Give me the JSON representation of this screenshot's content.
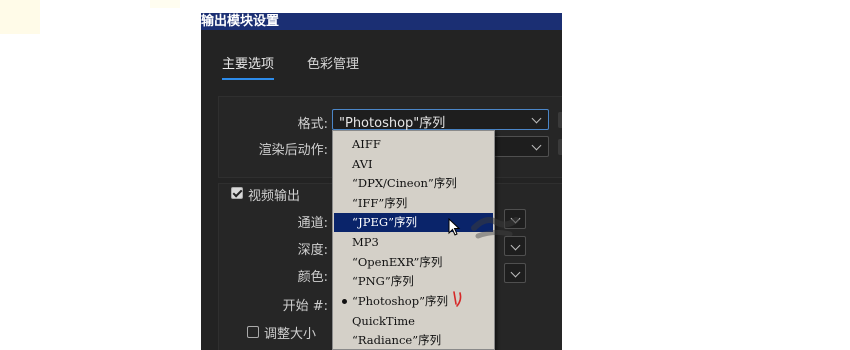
{
  "dialog": {
    "title": "输出模块设置"
  },
  "tabs": [
    {
      "label": "主要选项",
      "active": true
    },
    {
      "label": "色彩管理",
      "active": false
    }
  ],
  "format": {
    "label": "格式:",
    "value": "\"Photoshop\"序列"
  },
  "post_render": {
    "label": "渲染后动作:"
  },
  "video_output": {
    "label": "视频输出",
    "checked": true
  },
  "channels": {
    "label": "通道:"
  },
  "depth": {
    "label": "深度:"
  },
  "color": {
    "label": "颜色:"
  },
  "start": {
    "label": "开始 #:"
  },
  "resize": {
    "label": "调整大小",
    "checked": false
  },
  "dropdown": {
    "selected": "“JPEG”序列",
    "current": "“Photoshop”序列",
    "items": [
      "AIFF",
      "AVI",
      "“DPX/Cineon”序列",
      "“IFF”序列",
      "“JPEG”序列",
      "MP3",
      "“OpenEXR”序列",
      "“PNG”序列",
      "“Photoshop”序列",
      "QuickTime",
      "“Radiance”序列"
    ]
  },
  "colors": {
    "accent": "#2d8ceb",
    "selection": "#0a246a",
    "menu_bg": "#d4d0c8",
    "dialog_bg": "#232323"
  },
  "icons": {
    "dropdown_arrow": "chevron-down-icon",
    "mouse": "cursor-arrow-icon"
  }
}
